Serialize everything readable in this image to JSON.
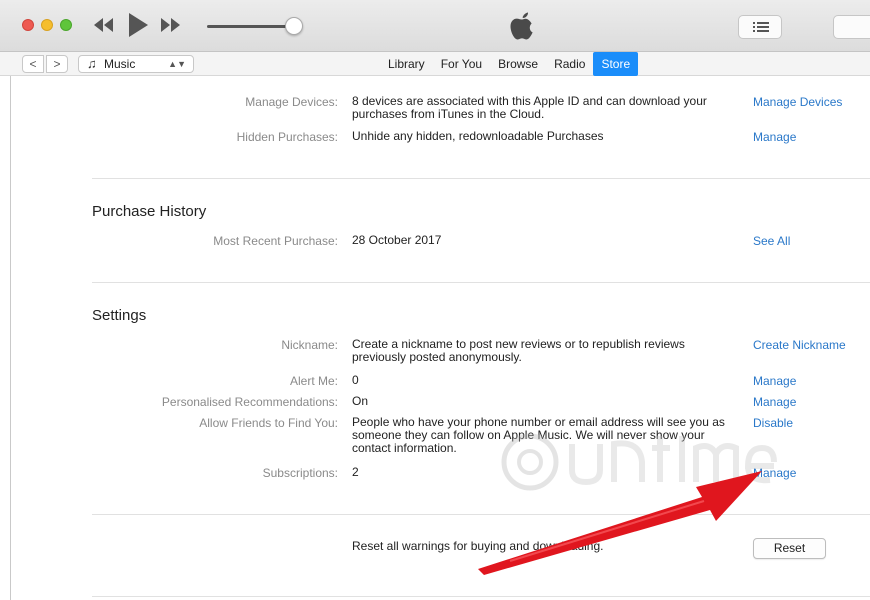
{
  "toolbar": {
    "volume_level": 0.88
  },
  "nav": {
    "back": "<",
    "forward": ">",
    "media_selector": "Music",
    "tabs": [
      {
        "label": "Library",
        "active": false
      },
      {
        "label": "For You",
        "active": false
      },
      {
        "label": "Browse",
        "active": false
      },
      {
        "label": "Radio",
        "active": false
      },
      {
        "label": "Store",
        "active": true
      }
    ]
  },
  "account": {
    "manage_devices": {
      "label": "Manage Devices:",
      "value": "8 devices are associated with this Apple ID and can download your purchases from iTunes in the Cloud.",
      "action": "Manage Devices"
    },
    "hidden_purchases": {
      "label": "Hidden Purchases:",
      "value": "Unhide any hidden, redownloadable Purchases",
      "action": "Manage"
    }
  },
  "purchase_history": {
    "title": "Purchase History",
    "most_recent": {
      "label": "Most Recent Purchase:",
      "value": "28 October 2017",
      "action": "See All"
    }
  },
  "settings": {
    "title": "Settings",
    "nickname": {
      "label": "Nickname:",
      "value": "Create a nickname to post new reviews or to republish reviews previously posted anonymously.",
      "action": "Create Nickname"
    },
    "alert_me": {
      "label": "Alert Me:",
      "value": "0",
      "action": "Manage"
    },
    "personalised": {
      "label": "Personalised Recommendations:",
      "value": "On",
      "action": "Manage"
    },
    "friends": {
      "label": "Allow Friends to Find You:",
      "value": "People who have your phone number or email address will see you as someone they can follow on Apple Music. We will never show your contact information.",
      "action": "Disable"
    },
    "subscriptions": {
      "label": "Subscriptions:",
      "value": "2",
      "action": "Manage"
    }
  },
  "reset": {
    "text": "Reset all warnings for buying and downloading.",
    "button": "Reset"
  },
  "colors": {
    "link": "#2a78c9",
    "active_tab": "#1a8dfa",
    "arrow": "#e0161e"
  },
  "icons": [
    "rewind-icon",
    "play-icon",
    "fast-forward-icon",
    "apple-logo-icon",
    "list-icon",
    "music-note-icon",
    "up-down-icon"
  ]
}
